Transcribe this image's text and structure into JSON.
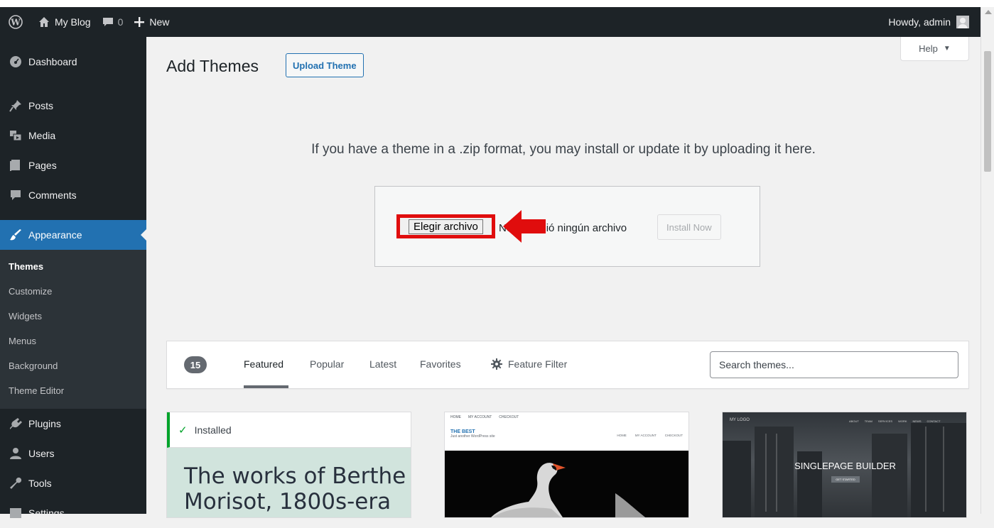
{
  "adminbar": {
    "site_name": "My Blog",
    "comments_count": "0",
    "new_label": "New",
    "howdy": "Howdy, admin"
  },
  "sidebar": {
    "items": [
      {
        "label": "Dashboard",
        "icon": "dashboard-icon"
      },
      {
        "label": "Posts",
        "icon": "pin-icon"
      },
      {
        "label": "Media",
        "icon": "media-icon"
      },
      {
        "label": "Pages",
        "icon": "pages-icon"
      },
      {
        "label": "Comments",
        "icon": "comment-icon"
      },
      {
        "label": "Appearance",
        "icon": "paintbrush-icon",
        "active": true
      }
    ],
    "submenu": [
      "Themes",
      "Customize",
      "Widgets",
      "Menus",
      "Background",
      "Theme Editor"
    ],
    "items_after": [
      {
        "label": "Plugins",
        "icon": "plugin-icon"
      },
      {
        "label": "Users",
        "icon": "users-icon"
      },
      {
        "label": "Tools",
        "icon": "wrench-icon"
      },
      {
        "label": "Settings",
        "icon": "settings-icon"
      }
    ]
  },
  "header": {
    "help_label": "Help",
    "title": "Add Themes",
    "upload_theme_label": "Upload Theme"
  },
  "upload": {
    "description": "If you have a theme in a .zip format, you may install or update it by uploading it here.",
    "choose_file_label": "Elegir archivo",
    "no_file_text": "No se eligió ningún archivo",
    "install_label": "Install Now"
  },
  "filter": {
    "count": "15",
    "tabs": [
      "Featured",
      "Popular",
      "Latest",
      "Favorites"
    ],
    "feature_filter_label": "Feature Filter",
    "search_placeholder": "Search themes..."
  },
  "themes": {
    "card1": {
      "installed_label": "Installed",
      "preview_line1": "The works of Berthe",
      "preview_line2": "Morisot, 1800s-era"
    },
    "card2": {
      "nav": [
        "HOME",
        "MY ACCOUNT",
        "CHECKOUT"
      ],
      "title": "THE BEST",
      "subtitle": "Just another WordPress site",
      "menu": [
        "HOME",
        "MY ACCOUNT",
        "CHECKOUT"
      ]
    },
    "card3": {
      "logo": "MY LOGO",
      "menu": [
        "ABOUT",
        "TEAM",
        "SERVICES",
        "WORK",
        "NEWS",
        "CONTACT"
      ],
      "title": "SINGLEPAGE BUILDER",
      "button": "GET STARTED"
    }
  },
  "colors": {
    "admin_dark": "#1d2327",
    "accent_blue": "#2271b1",
    "highlight_red": "#e00d0d",
    "installed_green": "#00a32a"
  }
}
